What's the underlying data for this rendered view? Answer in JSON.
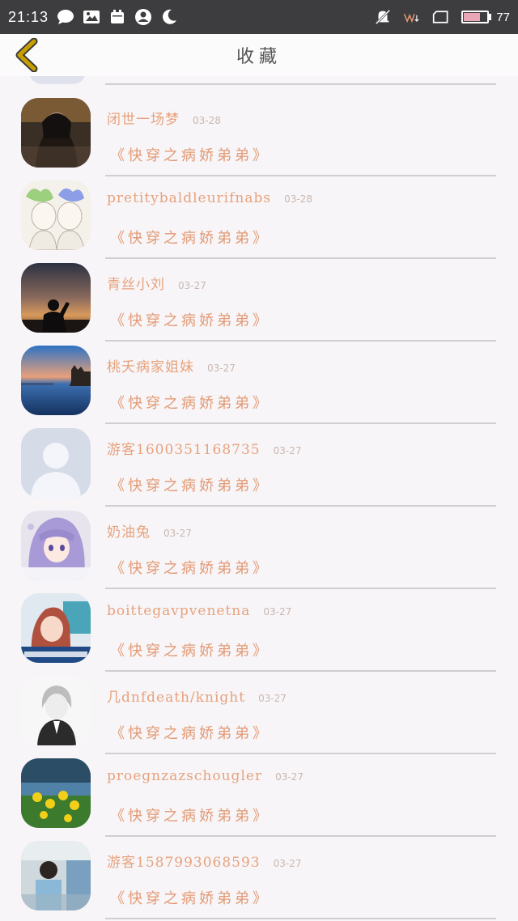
{
  "status_bar": {
    "time": "21:13",
    "battery_level": "77",
    "battery_fraction": 0.77
  },
  "nav": {
    "title": "收藏"
  },
  "colors": {
    "name": "#e7a27c",
    "book": "#e39a74",
    "date": "#c9b7b0",
    "status_bar": "#3d3d3f",
    "back_icon": "#c6a000"
  },
  "rows": [
    {
      "name": "闭世一场梦",
      "date": "03-28",
      "book": "《快穿之病娇弟弟》",
      "avatar": "portrait-dark"
    },
    {
      "name": "pretitybaldleurifnabs",
      "date": "03-28",
      "book": "《快穿之病娇弟弟》",
      "avatar": "sketch-girls"
    },
    {
      "name": "青丝小刘",
      "date": "03-27",
      "book": "《快穿之病娇弟弟》",
      "avatar": "sunset-silhouette"
    },
    {
      "name": "桃夭病家姐妹",
      "date": "03-27",
      "book": "《快穿之病娇弟弟》",
      "avatar": "castle-lake"
    },
    {
      "name": "游客1600351168735",
      "date": "03-27",
      "book": "《快穿之病娇弟弟》",
      "avatar": "default-person"
    },
    {
      "name": "奶油兔",
      "date": "03-27",
      "book": "《快穿之病娇弟弟》",
      "avatar": "anime-girl"
    },
    {
      "name": "boittegavpvenetna",
      "date": "03-27",
      "book": "《快穿之病娇弟弟》",
      "avatar": "girl-peace"
    },
    {
      "name": "几dnfdeath/knight",
      "date": "03-27",
      "book": "《快穿之病娇弟弟》",
      "avatar": "suit-boy"
    },
    {
      "name": "proegnzazschougler",
      "date": "03-27",
      "book": "《快穿之病娇弟弟》",
      "avatar": "yellow-flowers"
    },
    {
      "name": "游客1587993068593",
      "date": "03-27",
      "book": "《快穿之病娇弟弟》",
      "avatar": "kid-classroom"
    }
  ]
}
